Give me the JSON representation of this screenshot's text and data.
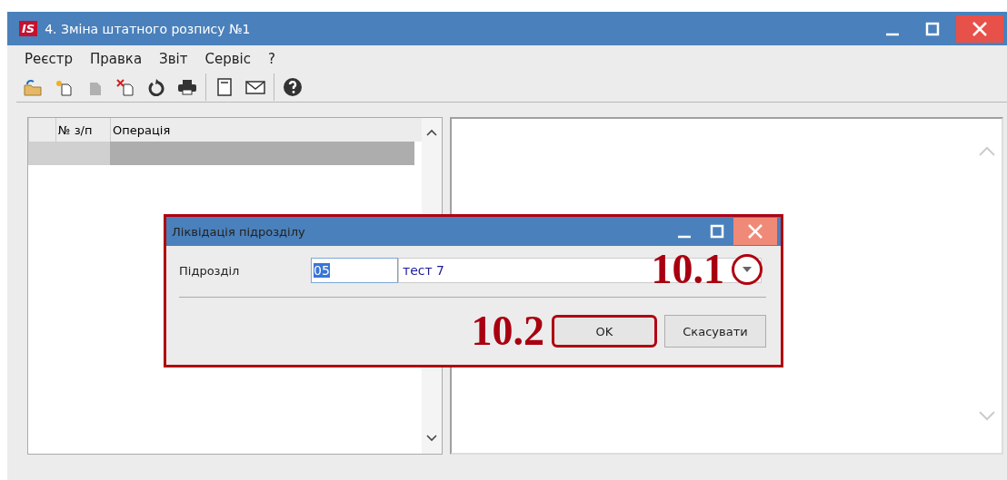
{
  "window": {
    "logo": "IS",
    "title": "4. Зміна штатного розпису №1"
  },
  "menu": [
    "Реєстр",
    "Правка",
    "Звіт",
    "Сервіс",
    "?"
  ],
  "toolbar": [
    {
      "kind": "open",
      "disabled": false
    },
    {
      "kind": "new",
      "disabled": false
    },
    {
      "kind": "edit",
      "disabled": true
    },
    {
      "kind": "delete",
      "disabled": false
    },
    {
      "kind": "refresh",
      "disabled": false
    },
    {
      "kind": "print",
      "disabled": false
    },
    {
      "kind": "separator"
    },
    {
      "kind": "notebook",
      "disabled": false
    },
    {
      "kind": "mail",
      "disabled": false
    },
    {
      "kind": "separator"
    },
    {
      "kind": "help",
      "disabled": false
    }
  ],
  "table": {
    "columns": [
      "№ з/п",
      "Операція"
    ],
    "rows": [
      {
        "cells": [
          "",
          ""
        ],
        "selected": true
      }
    ]
  },
  "dialog": {
    "title": "Ліквідація підрозділу",
    "field_label": "Підрозділ",
    "code": "05",
    "code_selected": true,
    "name": "тест 7",
    "buttons": [
      {
        "label": "OK",
        "kind": "ok"
      },
      {
        "label": "Скасувати",
        "kind": "cancel"
      }
    ]
  },
  "annotations": [
    "10.1",
    "10.2"
  ]
}
